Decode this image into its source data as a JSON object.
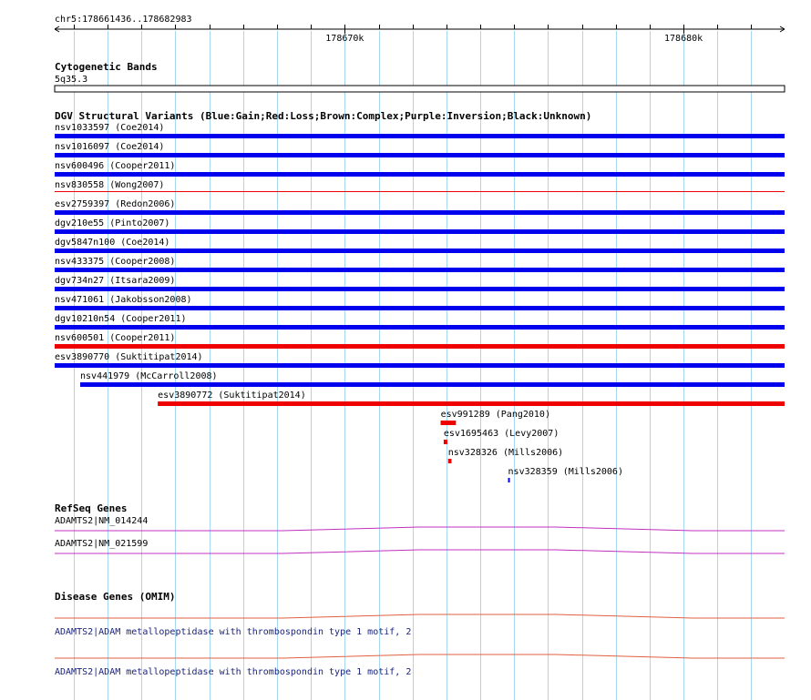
{
  "ruler": {
    "coordinates": "chr5:178661436..178682983",
    "start": 178661436,
    "end": 178682983,
    "ticks": [
      {
        "pos": 178670000,
        "label": "178670k"
      },
      {
        "pos": 178680000,
        "label": "178680k"
      }
    ]
  },
  "cytoband": {
    "title": "Cytogenetic Bands",
    "band": "5q35.3"
  },
  "dgv": {
    "title": "DGV Structural Variants (Blue:Gain;Red:Loss;Brown:Complex;Purple:Inversion;Black:Unknown)",
    "colors": {
      "Gain": "#0000ee",
      "Loss": "#ee0000"
    },
    "variants": [
      {
        "label": "nsv1033597 (Coe2014)",
        "type": "Gain",
        "start": 178661436,
        "end": 178682983
      },
      {
        "label": "nsv1016097 (Coe2014)",
        "type": "Gain",
        "start": 178661436,
        "end": 178682983
      },
      {
        "label": "nsv600496 (Cooper2011)",
        "type": "Gain",
        "start": 178661436,
        "end": 178682983
      },
      {
        "label": "nsv830558 (Wong2007)",
        "type": "Loss",
        "start": 178661436,
        "end": 178682983,
        "thin": true
      },
      {
        "label": "esv2759397 (Redon2006)",
        "type": "Gain",
        "start": 178661436,
        "end": 178682983
      },
      {
        "label": "dgv210e55 (Pinto2007)",
        "type": "Gain",
        "start": 178661436,
        "end": 178682983
      },
      {
        "label": "dgv5847n100 (Coe2014)",
        "type": "Gain",
        "start": 178661436,
        "end": 178682983
      },
      {
        "label": "nsv433375 (Cooper2008)",
        "type": "Gain",
        "start": 178661436,
        "end": 178682983
      },
      {
        "label": "dgv734n27 (Itsara2009)",
        "type": "Gain",
        "start": 178661436,
        "end": 178682983
      },
      {
        "label": "nsv471061 (Jakobsson2008)",
        "type": "Gain",
        "start": 178661436,
        "end": 178682983
      },
      {
        "label": "dgv10210n54 (Cooper2011)",
        "type": "Gain",
        "start": 178661436,
        "end": 178682983
      },
      {
        "label": "nsv600501 (Cooper2011)",
        "type": "Loss",
        "start": 178661436,
        "end": 178682983
      },
      {
        "label": "esv3890770 (Suktitipat2014)",
        "type": "Gain",
        "start": 178661436,
        "end": 178682983
      },
      {
        "label": "nsv441979 (McCarroll2008)",
        "type": "Gain",
        "start": 178662190,
        "end": 178682983
      },
      {
        "label": "esv3890772 (Suktitipat2014)",
        "type": "Loss",
        "start": 178664480,
        "end": 178682983
      },
      {
        "label": "esv991289 (Pang2010)",
        "type": "Loss",
        "start": 178672830,
        "end": 178673280
      },
      {
        "label": "esv1695463 (Levy2007)",
        "type": "Loss",
        "start": 178672920,
        "end": 178673030
      },
      {
        "label": "nsv328326 (Mills2006)",
        "type": "Loss",
        "start": 178673050,
        "end": 178673150
      },
      {
        "label": "nsv328359 (Mills2006)",
        "type": "Gain",
        "start": 178674820,
        "end": 178674870
      }
    ]
  },
  "refseq": {
    "title": "RefSeq Genes",
    "color": "#c030c0",
    "genes": [
      {
        "label": "ADAMTS2|NM_014244"
      },
      {
        "label": "ADAMTS2|NM_021599"
      }
    ]
  },
  "omim": {
    "title": "Disease Genes (OMIM)",
    "color": "#e06040",
    "genes": [
      {
        "label": "ADAMTS2|ADAM metallopeptidase with thrombospondin type 1 motif, 2"
      },
      {
        "label": "ADAMTS2|ADAM metallopeptidase with thrombospondin type 1 motif, 2"
      }
    ]
  }
}
